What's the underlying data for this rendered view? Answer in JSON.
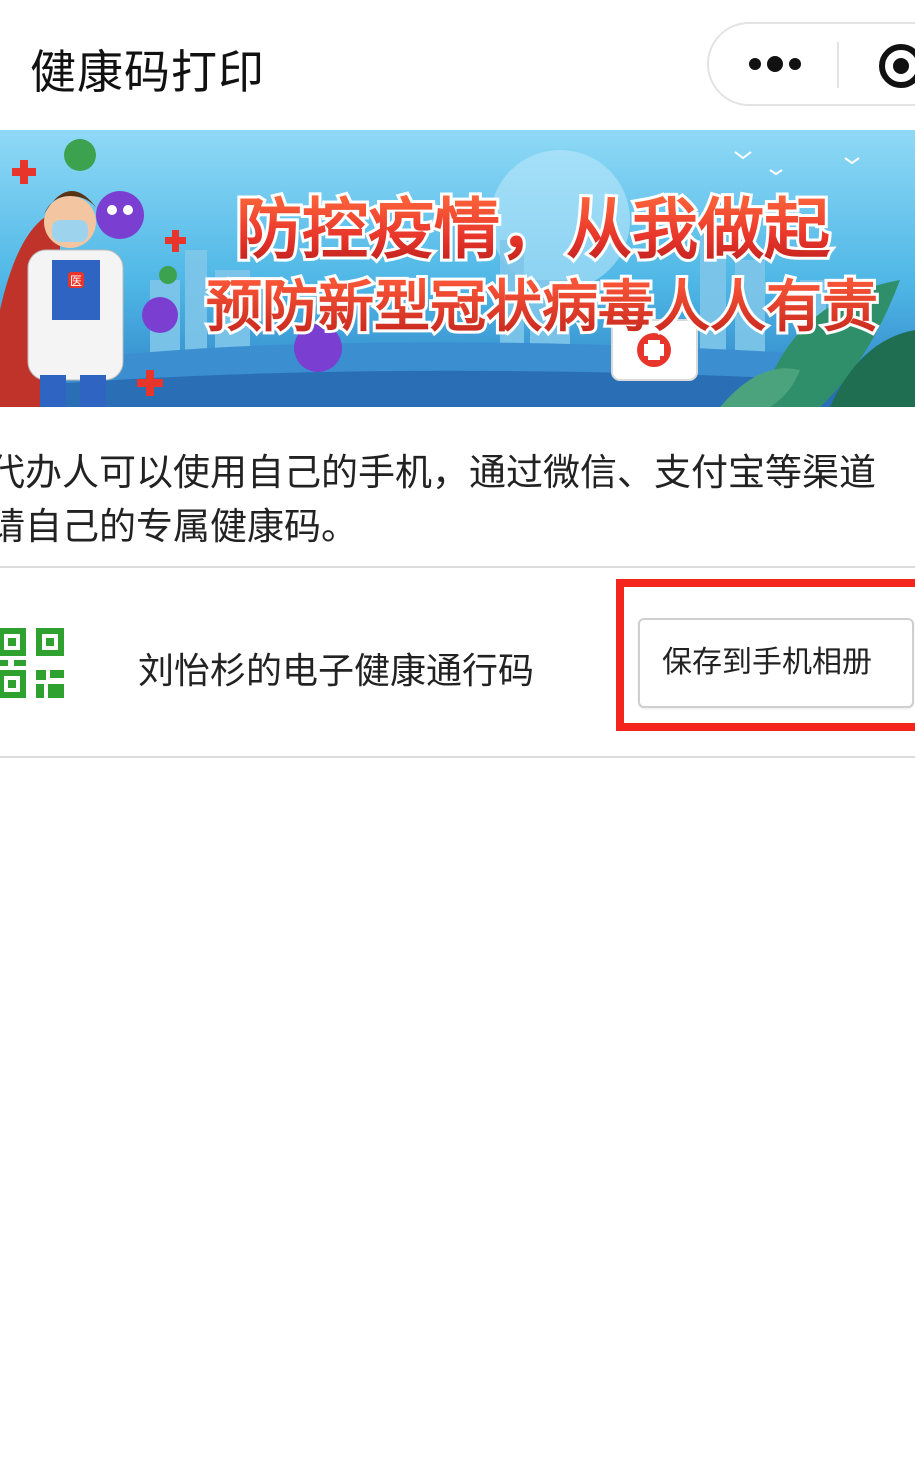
{
  "header": {
    "title": "健康码打印",
    "more_icon": "more-dots-icon",
    "close_icon": "close-target-icon"
  },
  "banner": {
    "headline": "防控疫情，从我做起",
    "subline": "预防新型冠状病毒人人有责",
    "badge_text": "医"
  },
  "description": {
    "line1": "代办人可以使用自己的手机，通过微信、支付宝等渠道",
    "line2": "请自己的专属健康码。"
  },
  "code_item": {
    "icon": "qr-code-icon",
    "label": "刘怡杉的电子健康通行码",
    "save_label": "保存到手机相册"
  },
  "colors": {
    "qr_green": "#2ea12e",
    "highlight_red": "#f2261d",
    "banner_red": "#e8352b",
    "banner_sky": "#5fc3ea"
  }
}
